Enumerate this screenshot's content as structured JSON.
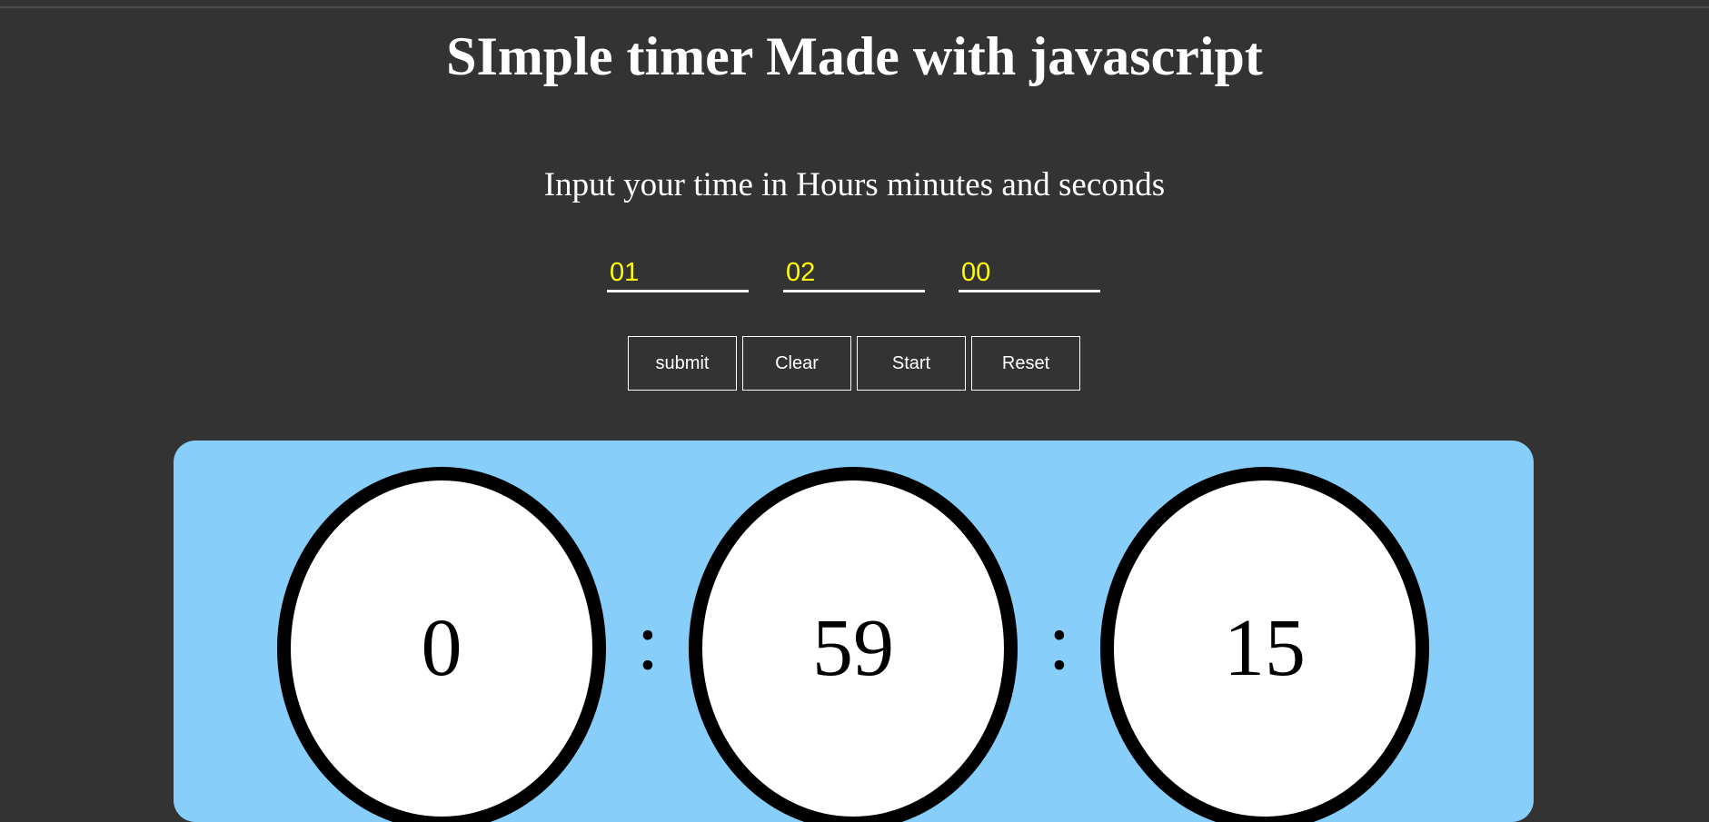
{
  "header": {
    "title": "SImple timer Made with javascript",
    "subtitle": "Input your time in Hours minutes and seconds"
  },
  "inputs": {
    "hours": "01",
    "minutes": "02",
    "seconds": "00"
  },
  "buttons": {
    "submit": "submit",
    "clear": "Clear",
    "start": "Start",
    "reset": "Reset"
  },
  "display": {
    "hours": "0",
    "minutes": "59",
    "seconds": "15",
    "separator": ":"
  },
  "colors": {
    "background": "#333333",
    "panel": "#87cefa",
    "input_text": "#ffff00",
    "text": "#ffffff"
  }
}
